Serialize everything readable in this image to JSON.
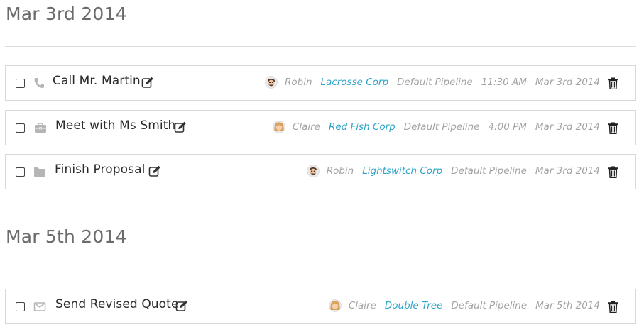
{
  "groups": [
    {
      "date": "Mar 3rd 2014",
      "tasks": [
        {
          "type_icon": "phone-icon",
          "title": "Call Mr. Martin",
          "owner": "Robin",
          "owner_avatar": "robin-avatar",
          "company": "Lacrosse Corp",
          "pipeline": "Default Pipeline",
          "time": "11:30 AM",
          "date": "Mar 3rd 2014"
        },
        {
          "type_icon": "briefcase-icon",
          "title": "Meet with Ms Smith",
          "owner": "Claire",
          "owner_avatar": "claire-avatar",
          "company": "Red Fish Corp",
          "pipeline": "Default Pipeline",
          "time": "4:00 PM",
          "date": "Mar 3rd 2014"
        },
        {
          "type_icon": "folder-icon",
          "title": "Finish Proposal",
          "owner": "Robin",
          "owner_avatar": "robin-avatar",
          "company": "Lightswitch Corp",
          "pipeline": "Default Pipeline",
          "time": "",
          "date": "Mar 3rd 2014"
        }
      ]
    },
    {
      "date": "Mar 5th 2014",
      "tasks": [
        {
          "type_icon": "envelope-icon",
          "title": "Send Revised Quote",
          "owner": "Claire",
          "owner_avatar": "claire-avatar",
          "company": "Double Tree",
          "pipeline": "Default Pipeline",
          "time": "",
          "date": "Mar 5th 2014"
        }
      ]
    }
  ],
  "colors": {
    "company_link": "#2fa4c7",
    "meta_text": "#a3a3a3",
    "heading_text": "#6b6b6b"
  }
}
